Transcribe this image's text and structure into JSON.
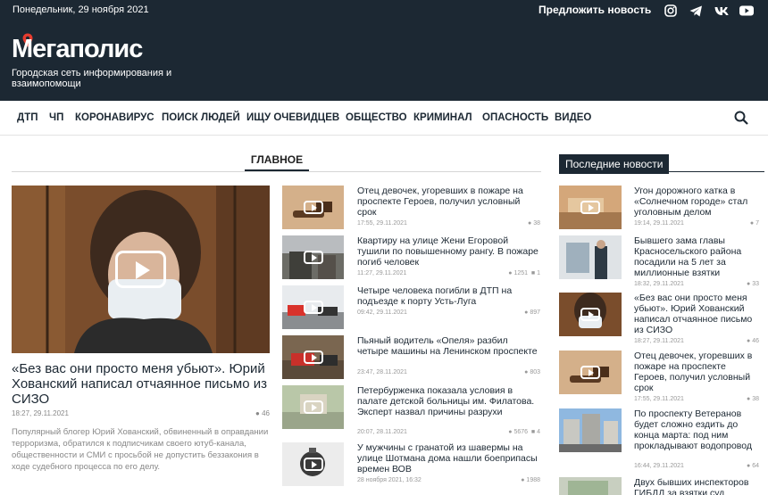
{
  "topbar": {
    "date": "Понедельник, 29 ноября 2021",
    "suggest": "Предложить новость",
    "social": [
      "instagram-icon",
      "telegram-icon",
      "vk-icon",
      "youtube-icon"
    ]
  },
  "header": {
    "logo": "Мегаполис",
    "tagline": "Городская сеть информирования и взаимопомощи"
  },
  "nav": {
    "items": [
      "ДТП",
      "ЧП",
      "КОРОНАВИРУС",
      "ПОИСК ЛЮДЕЙ",
      "ИЩУ ОЧЕВИДЦЕВ",
      "ОБЩЕСТВО",
      "КРИМИНАЛ",
      "ОПАСНОСТЬ",
      "ВИДЕО"
    ]
  },
  "main": {
    "tab": "ГЛАВНОЕ",
    "hero": {
      "title": "«Без вас они просто меня убьют». Юрий Хованский написал отчаянное письмо из СИЗО",
      "time": "18:27, 29.11.2021",
      "views": "46",
      "desc": "Популярный блогер Юрий Хованский, обвиненный в оправдании терроризма, обратился к подписчикам своего ютуб-канала, общественности и СМИ с просьбой не допустить беззакония в ходе судебного процесса по его делу."
    },
    "news": [
      {
        "title": "Отец девочек, угоревших в пожаре на проспекте Героев, получил условный срок",
        "time": "17:55, 29.11.2021",
        "views": "38",
        "comments": ""
      },
      {
        "title": "Квартиру на улице Жени Егоровой тушили по повышенному рангу. В пожаре погиб человек",
        "time": "11:27, 29.11.2021",
        "views": "1251",
        "comments": "1"
      },
      {
        "title": "Четыре человека погибли в ДТП на подъезде к порту Усть-Луга",
        "time": "09:42, 29.11.2021",
        "views": "897",
        "comments": ""
      },
      {
        "title": "Пьяный водитель «Опеля» разбил четыре машины на Ленинском проспекте",
        "time": "23:47, 28.11.2021",
        "views": "803",
        "comments": ""
      },
      {
        "title": "Петербурженка показала условия в палате детской больницы им. Филатова. Эксперт назвал причины разрухи",
        "time": "20:07, 28.11.2021",
        "views": "5676",
        "comments": "4"
      },
      {
        "title": "У мужчины с гранатой из шавермы на улице Шотмана дома нашли боеприпасы времен ВОВ",
        "time": "28 ноября 2021, 16:32",
        "views": "1988",
        "comments": ""
      }
    ]
  },
  "latest": {
    "heading": "Последние новости",
    "items": [
      {
        "title": "Угон дорожного катка в «Солнечном городе» стал уголовным делом",
        "time": "19:14, 29.11.2021",
        "views": "7"
      },
      {
        "title": "Бывшего зама главы Красносельского района посадили на 5 лет за миллионные взятки",
        "time": "18:32, 29.11.2021",
        "views": "33"
      },
      {
        "title": "«Без вас они просто меня убьют». Юрий Хованский написал отчаянное письмо из СИЗО",
        "time": "18:27, 29.11.2021",
        "views": "46"
      },
      {
        "title": "Отец девочек, угоревших в пожаре на проспекте Героев, получил условный срок",
        "time": "17:55, 29.11.2021",
        "views": "38"
      },
      {
        "title": "По проспекту Ветеранов будет сложно ездить до конца марта: под ним прокладывают водопровод",
        "time": "16:44, 29.11.2021",
        "views": "64"
      },
      {
        "title": "Двух бывших инспекторов ГИБДД за взятки суд",
        "time": "",
        "views": ""
      }
    ]
  }
}
